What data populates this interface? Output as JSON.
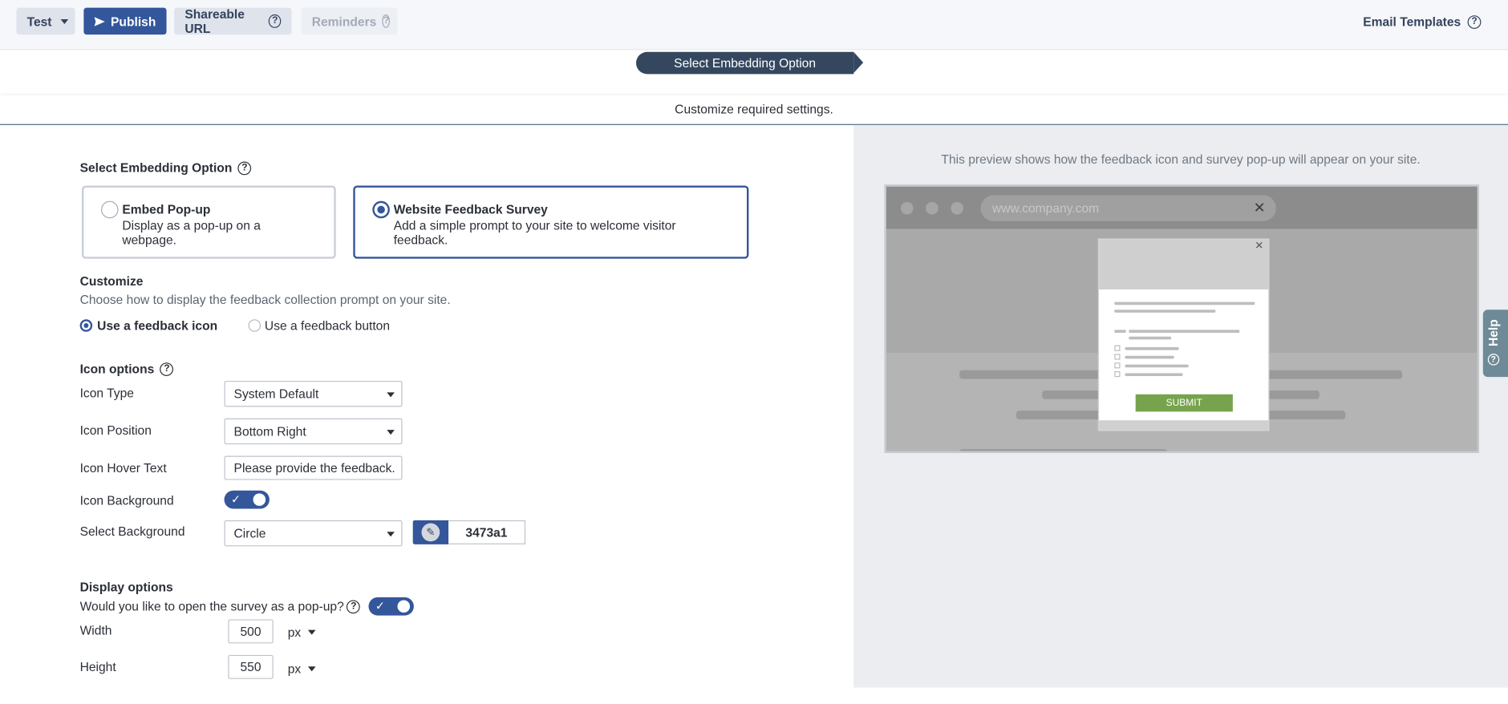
{
  "toolbar": {
    "test_label": "Test",
    "publish_label": "Publish",
    "shareable_label": "Shareable URL",
    "reminders_label": "Reminders",
    "email_templates_label": "Email Templates"
  },
  "step": {
    "title": "Select Embedding Option"
  },
  "subtitle": "Customize required settings.",
  "embedding": {
    "heading": "Select Embedding Option",
    "options": [
      {
        "title": "Embed Pop-up",
        "desc_line1": "Display as a pop-up on a",
        "desc_line2": "webpage.",
        "selected": false
      },
      {
        "title": "Website Feedback Survey",
        "desc_line1": "Add a simple prompt to your site to welcome visitor",
        "desc_line2": "feedback.",
        "selected": true
      }
    ]
  },
  "customize": {
    "heading": "Customize",
    "desc": "Choose how to display the feedback collection prompt on your site.",
    "radio_icon": "Use a feedback icon",
    "radio_button": "Use a feedback button",
    "selected": "icon"
  },
  "icon_options": {
    "heading": "Icon options",
    "type_label": "Icon Type",
    "type_value": "System Default",
    "position_label": "Icon Position",
    "position_value": "Bottom Right",
    "hover_label": "Icon Hover Text",
    "hover_value": "Please provide the feedback.",
    "background_label": "Icon Background",
    "background_on": true,
    "select_bg_label": "Select Background",
    "select_bg_value": "Circle",
    "color_value": "3473a1"
  },
  "display_options": {
    "heading": "Display options",
    "popup_question": "Would you like to open the survey as a pop-up?",
    "popup_on": true,
    "width_label": "Width",
    "width_value": "500",
    "width_unit": "px",
    "height_label": "Height",
    "height_value": "550",
    "height_unit": "px"
  },
  "preview": {
    "note": "This preview shows how the feedback icon and survey pop-up will appear on your site.",
    "url": "www.company.com",
    "submit_label": "SUBMIT"
  },
  "help_tab": "Help",
  "colors": {
    "brand": "#34569a",
    "step": "#34475f",
    "icon_bg": "#3473a1",
    "submit": "#77a34d"
  },
  "icons": [
    "caret-down-icon",
    "send-icon",
    "question-icon",
    "pencil-icon",
    "check-icon",
    "close-icon",
    "chat-icon"
  ]
}
